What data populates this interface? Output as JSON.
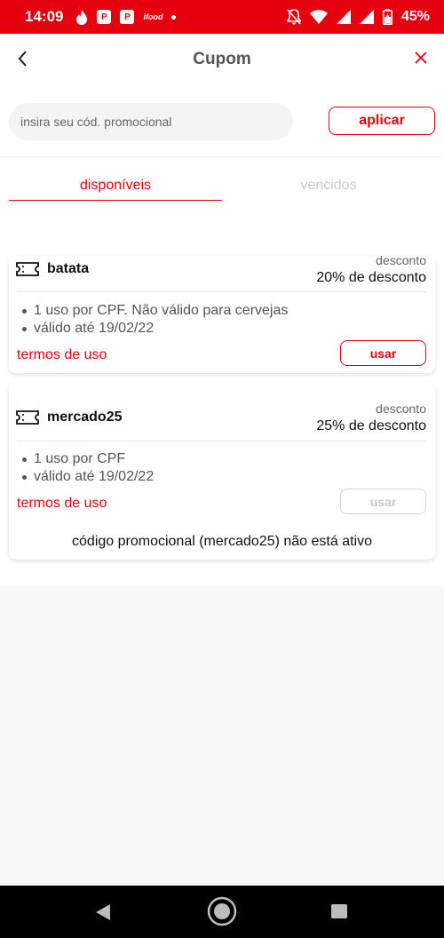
{
  "status_bar": {
    "time": "14:09",
    "battery": "45%",
    "left_icons": [
      "fire-icon",
      "p-app-icon",
      "p-app-icon",
      "ifood-icon",
      "dot-icon"
    ],
    "right_icons": [
      "bell-off-icon",
      "wifi-icon",
      "signal-icon",
      "signal-icon",
      "battery-icon"
    ],
    "color": "#e3000f",
    "icon_text": {
      "p1": "P",
      "p2": "P",
      "ifood": "ifood"
    }
  },
  "header": {
    "title": "Cupom",
    "back_icon": "chevron-left-icon",
    "close_icon": "close-icon",
    "accent_color": "#e3000f"
  },
  "promo": {
    "placeholder": "insira seu cód. promocional",
    "value": "",
    "apply_label": "aplicar"
  },
  "tabs": [
    {
      "label": "disponíveis",
      "active": true
    },
    {
      "label": "vencidos",
      "active": false
    }
  ],
  "coupons": [
    {
      "code": "batata",
      "discount_label": "desconto",
      "discount_value": "20% de desconto",
      "rules": [
        "1 uso por CPF. Não válido para cervejas",
        "válido até 19/02/22"
      ],
      "terms_label": "termos de uso",
      "use_label": "usar",
      "enabled": true
    },
    {
      "code": "mercado25",
      "discount_label": "desconto",
      "discount_value": "25% de desconto",
      "rules": [
        "1 uso por CPF",
        "válido até 19/02/22"
      ],
      "terms_label": "termos de uso",
      "use_label": "usar",
      "enabled": false,
      "inactive_message": "código promocional (mercado25) não está ativo"
    }
  ],
  "nav_bar": {
    "icons": [
      "back-triangle-icon",
      "home-circle-icon",
      "recents-square-icon"
    ]
  }
}
